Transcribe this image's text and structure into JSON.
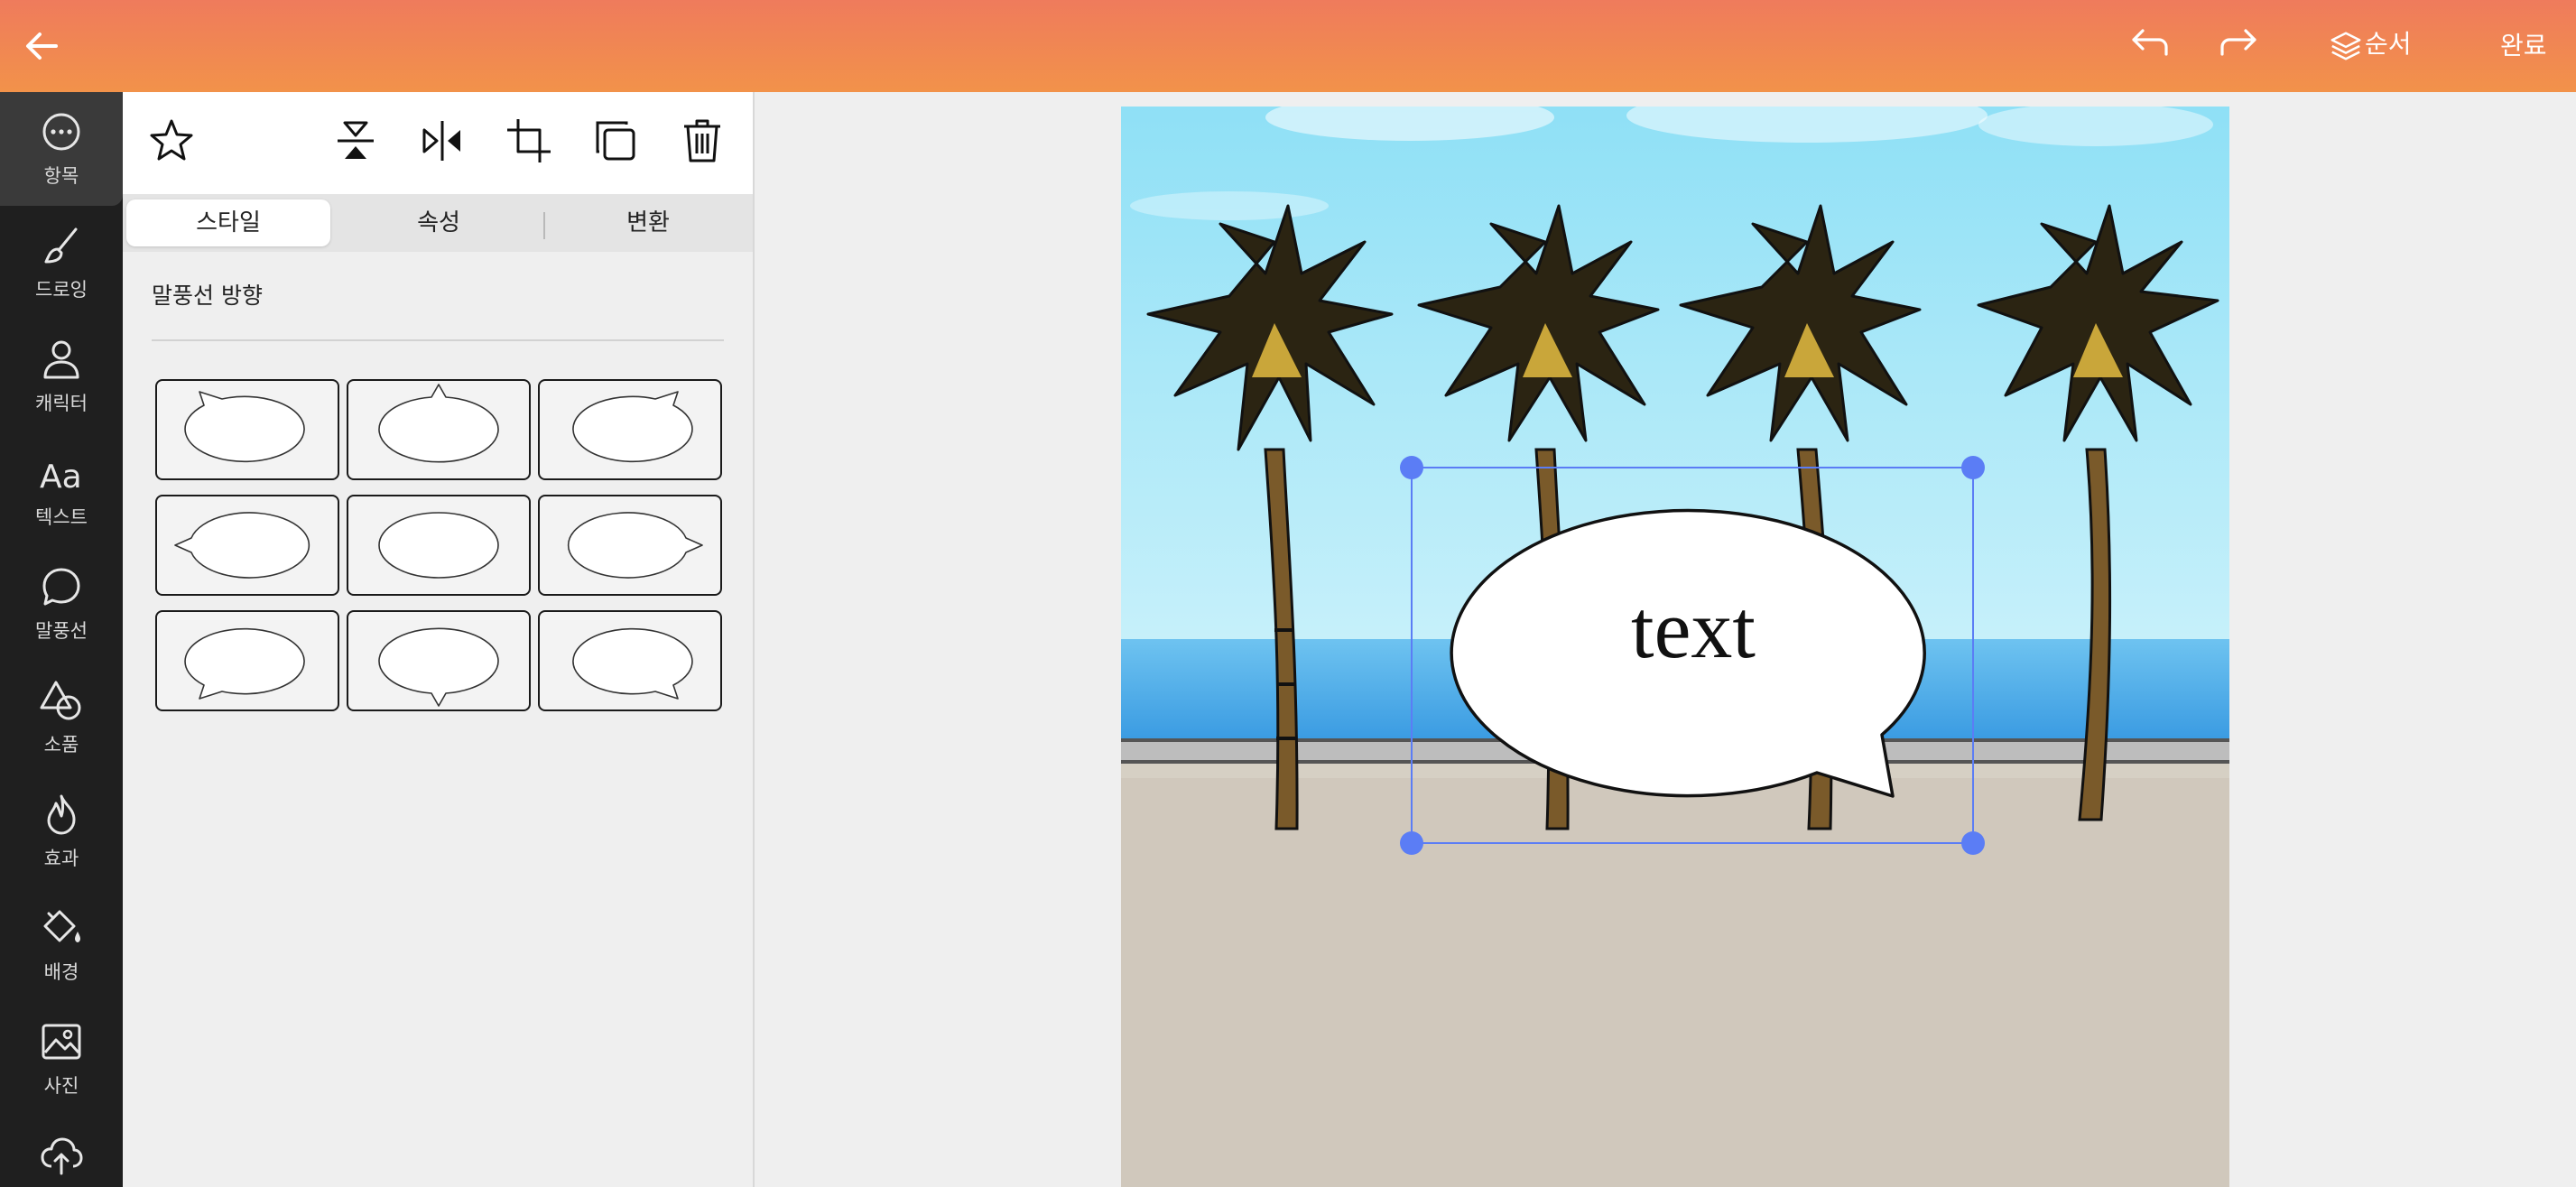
{
  "topbar": {
    "order_label": "순서",
    "done_label": "완료"
  },
  "rail": {
    "items": [
      {
        "label": "항목",
        "icon": "more-circle-icon"
      },
      {
        "label": "드로잉",
        "icon": "brush-icon"
      },
      {
        "label": "캐릭터",
        "icon": "person-icon"
      },
      {
        "label": "텍스트",
        "icon": "text-aa-icon"
      },
      {
        "label": "말풍선",
        "icon": "speech-bubble-icon"
      },
      {
        "label": "소품",
        "icon": "shapes-icon"
      },
      {
        "label": "효과",
        "icon": "flame-icon"
      },
      {
        "label": "배경",
        "icon": "paint-bucket-icon"
      },
      {
        "label": "사진",
        "icon": "image-icon"
      }
    ]
  },
  "panel": {
    "tabs": [
      {
        "label": "스타일",
        "active": true
      },
      {
        "label": "속성",
        "active": false
      },
      {
        "label": "변환",
        "active": false
      }
    ],
    "section_title": "말풍선 방향"
  },
  "canvas": {
    "bubble_text": "text"
  },
  "colors": {
    "accent_top": "#ef7b5c",
    "accent_bottom": "#f2924a",
    "rail_bg": "#1f1f1f",
    "selection": "#5b7df5"
  }
}
